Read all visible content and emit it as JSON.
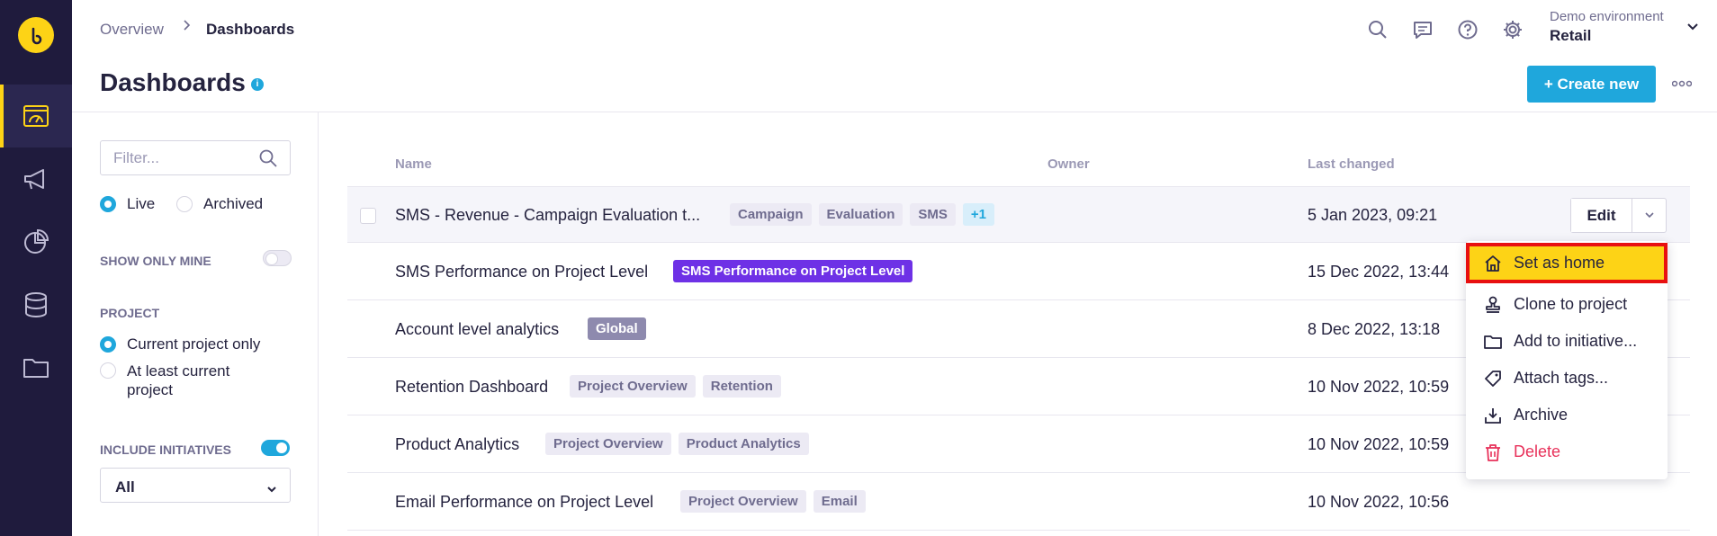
{
  "brand": {
    "accent": "#1fa7dc",
    "highlight": "#fdd316",
    "danger": "#e8315a",
    "rail_bg": "#1f1b3d"
  },
  "nav": {
    "items": [
      {
        "id": "dashboards",
        "icon": "dashboard-icon",
        "active": true
      },
      {
        "id": "campaigns",
        "icon": "megaphone-icon",
        "active": false
      },
      {
        "id": "analytics",
        "icon": "pie-chart-icon",
        "active": false
      },
      {
        "id": "data",
        "icon": "database-icon",
        "active": false
      },
      {
        "id": "files",
        "icon": "folder-icon",
        "active": false
      }
    ]
  },
  "header": {
    "breadcrumb": [
      "Overview",
      "Dashboards"
    ],
    "environment": {
      "label": "Demo environment",
      "value": "Retail"
    },
    "icons": [
      "search-icon",
      "chat-icon",
      "help-icon",
      "gear-icon"
    ]
  },
  "page": {
    "title": "Dashboards",
    "info": "i",
    "create_label": "+ Create new"
  },
  "filters": {
    "search_placeholder": "Filter...",
    "status_options": [
      {
        "label": "Live",
        "selected": true
      },
      {
        "label": "Archived",
        "selected": false
      }
    ],
    "show_only_mine": {
      "label": "SHOW ONLY MINE",
      "on": false
    },
    "project": {
      "label": "PROJECT",
      "options": [
        {
          "label": "Current project only",
          "selected": true
        },
        {
          "label": "At least current project",
          "selected": false
        }
      ]
    },
    "include_initiatives": {
      "label": "INCLUDE INITIATIVES",
      "on": true
    },
    "initiative_select": "All"
  },
  "table": {
    "columns": [
      "Name",
      "Owner",
      "Last changed"
    ],
    "rows": [
      {
        "name": "SMS - Revenue - Campaign Evaluation t...",
        "tags": [
          {
            "text": "Campaign"
          },
          {
            "text": "Evaluation"
          },
          {
            "text": "SMS"
          },
          {
            "text": "+1"
          }
        ],
        "last_changed": "5 Jan 2023, 09:21"
      },
      {
        "name": "SMS Performance on Project Level",
        "tags": [
          {
            "text": "SMS Performance on Project Level"
          }
        ],
        "last_changed": "15 Dec 2022, 13:44"
      },
      {
        "name": "Account level analytics",
        "tags": [
          {
            "text": "Global"
          }
        ],
        "last_changed": "8 Dec 2022, 13:18"
      },
      {
        "name": "Retention Dashboard",
        "tags": [
          {
            "text": "Project Overview"
          },
          {
            "text": "Retention"
          }
        ],
        "last_changed": "10 Nov 2022, 10:59"
      },
      {
        "name": "Product Analytics",
        "tags": [
          {
            "text": "Project Overview"
          },
          {
            "text": "Product Analytics"
          }
        ],
        "last_changed": "10 Nov 2022, 10:59"
      },
      {
        "name": "Email Performance on Project Level",
        "tags": [
          {
            "text": "Project Overview"
          },
          {
            "text": "Email"
          }
        ],
        "last_changed": "10 Nov 2022, 10:56"
      }
    ],
    "edit_label": "Edit"
  },
  "row_menu": {
    "items": [
      {
        "label": "Set as home",
        "icon": "home-icon"
      },
      {
        "label": "Clone to project",
        "icon": "stamp-icon"
      },
      {
        "label": "Add to initiative...",
        "icon": "folder-icon"
      },
      {
        "label": "Attach tags...",
        "icon": "tag-icon"
      },
      {
        "label": "Archive",
        "icon": "archive-download-icon"
      },
      {
        "label": "Delete",
        "icon": "trash-icon"
      }
    ]
  }
}
